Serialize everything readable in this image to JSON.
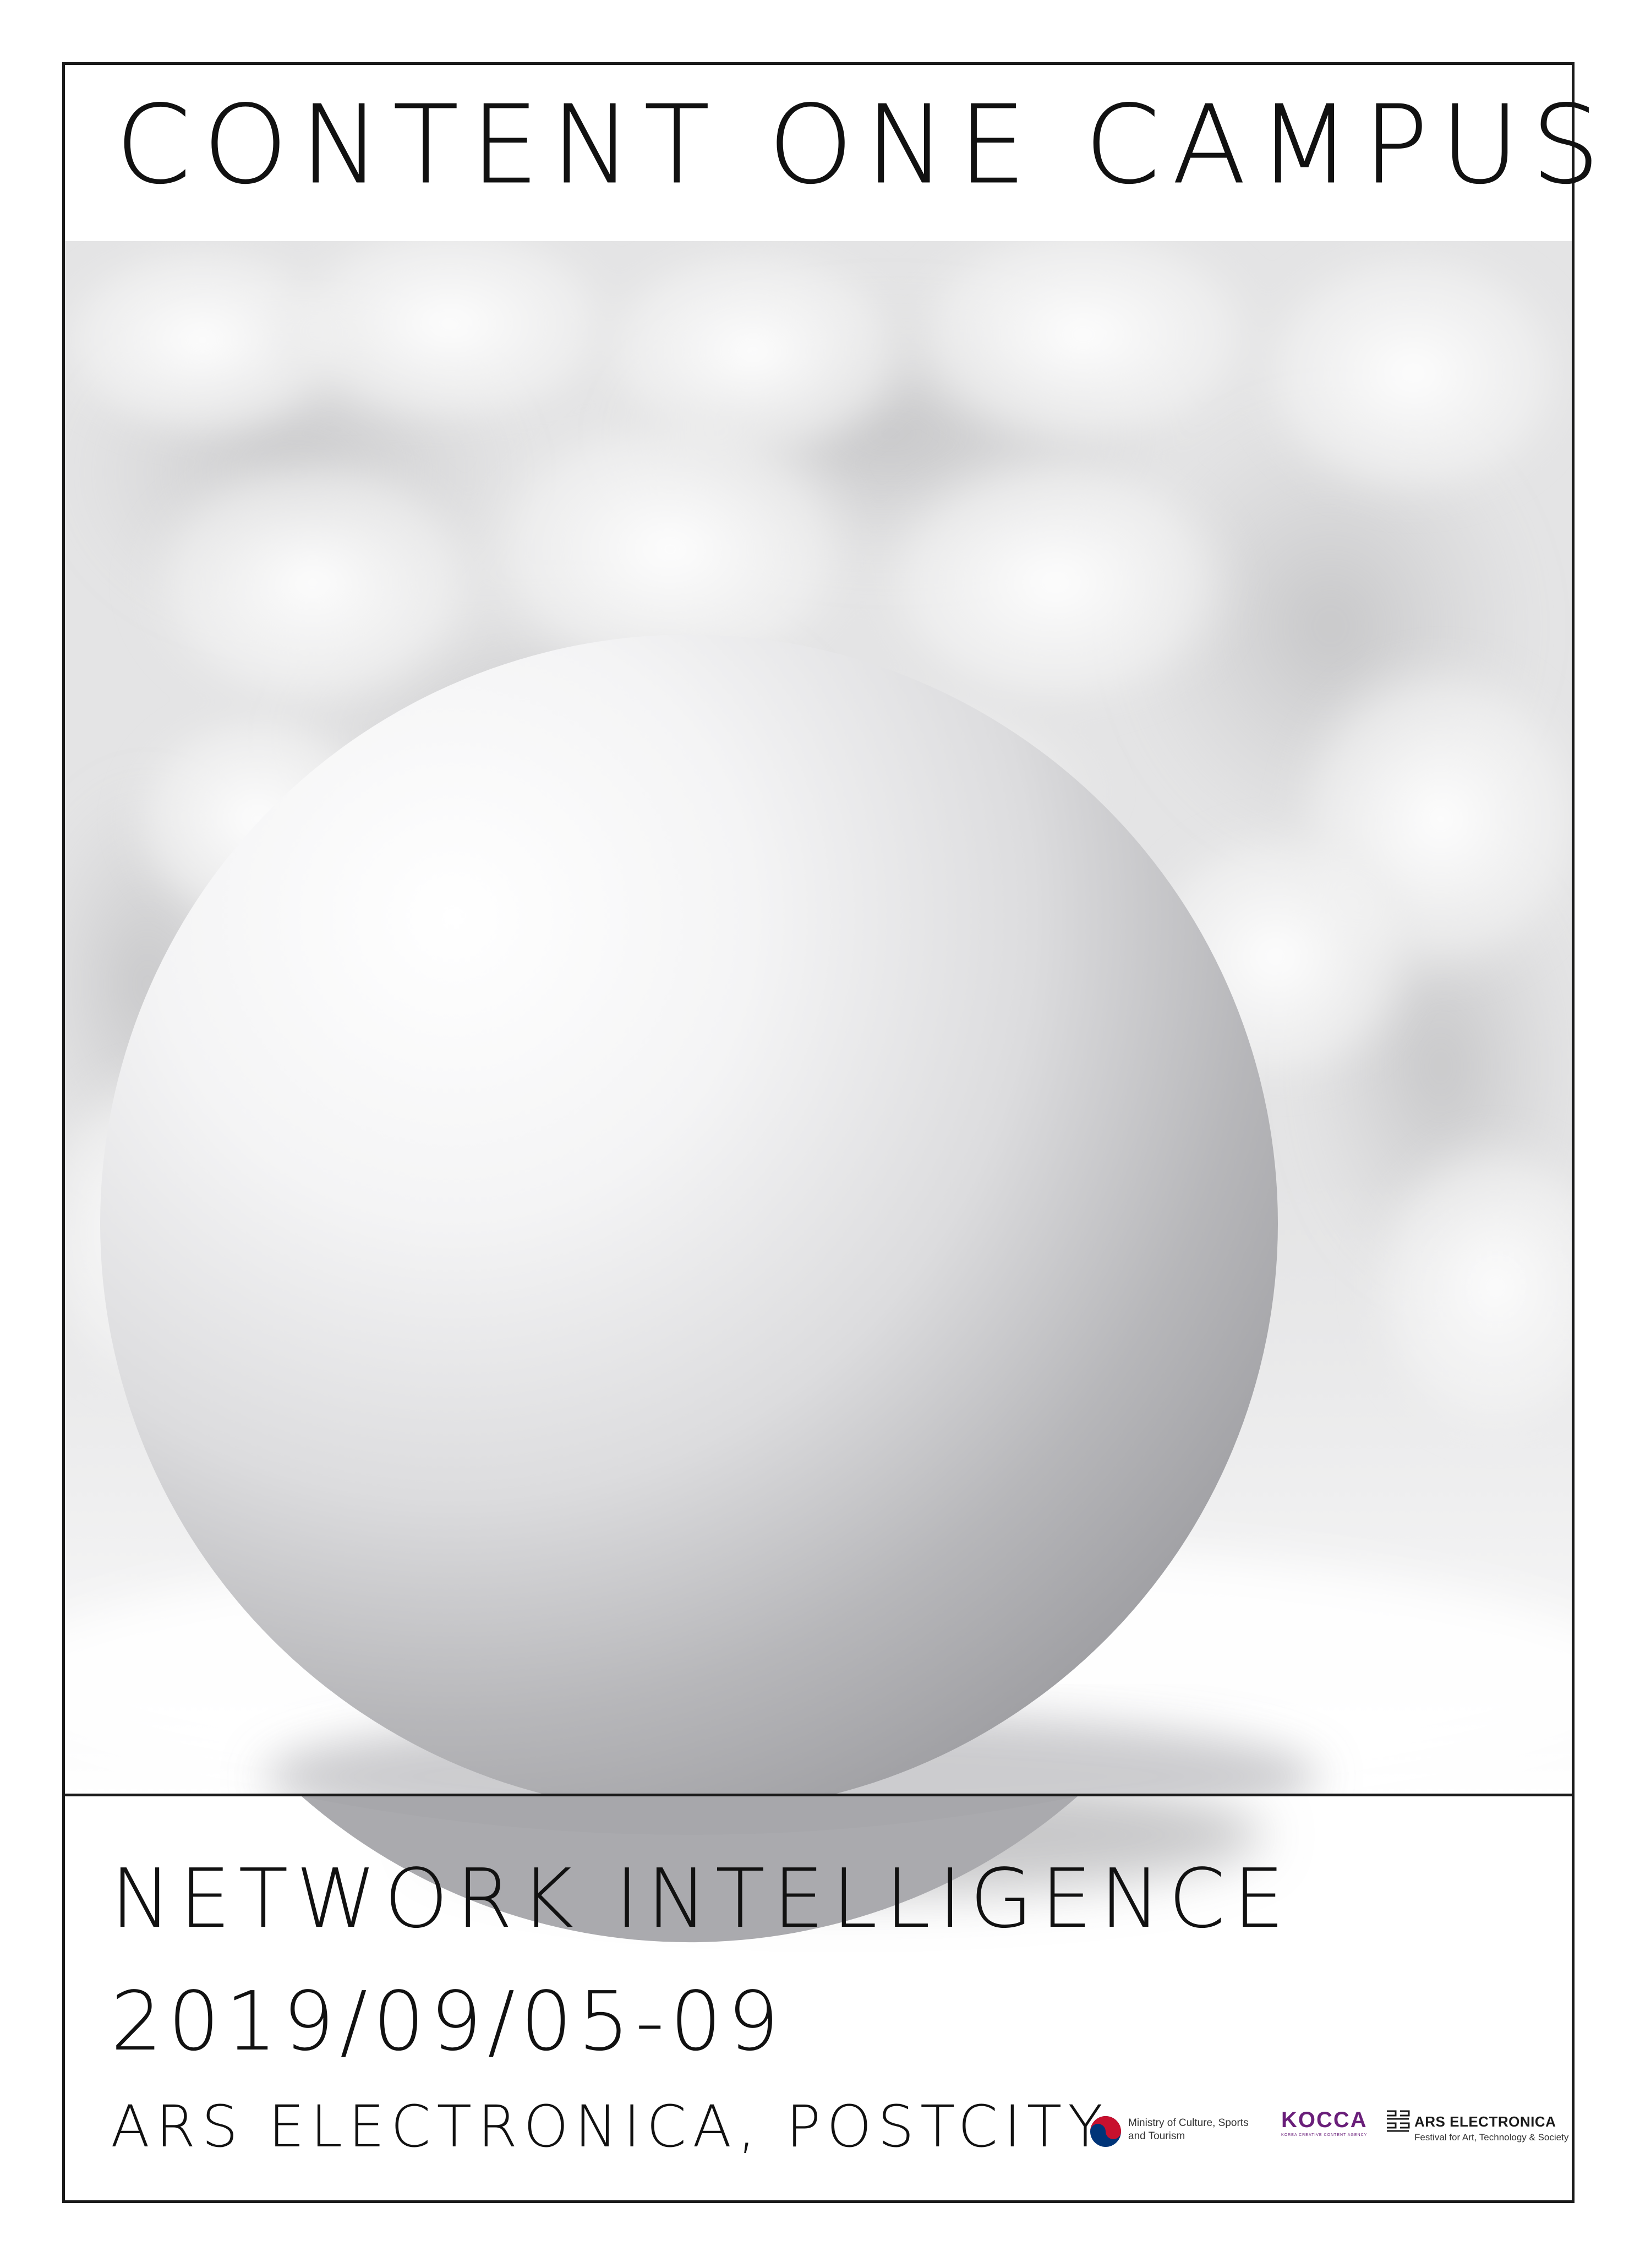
{
  "poster": {
    "title": "CONTENT ONE CAMPUS",
    "headline": "NETWORK INTELLIGENCE",
    "dates": "2019/09/05-09",
    "venue": "ARS ELECTRONICA, POSTCITY"
  },
  "logos": {
    "ministry": {
      "icon": "taegeuk-icon",
      "line1": "Ministry of Culture, Sports",
      "line2": "and Tourism"
    },
    "kocca": {
      "word": "KOCCA",
      "sub": "KOREA CREATIVE CONTENT AGENCY"
    },
    "ars": {
      "icon": "ars-electronica-mark-icon",
      "word": "ARS ELECTRONICA",
      "sub": "Festival for Art, Technology & Society"
    }
  },
  "colors": {
    "ink": "#111111",
    "kocca_purple": "#6a1f7a",
    "taegeuk_red": "#c8102e",
    "taegeuk_blue": "#003478"
  }
}
